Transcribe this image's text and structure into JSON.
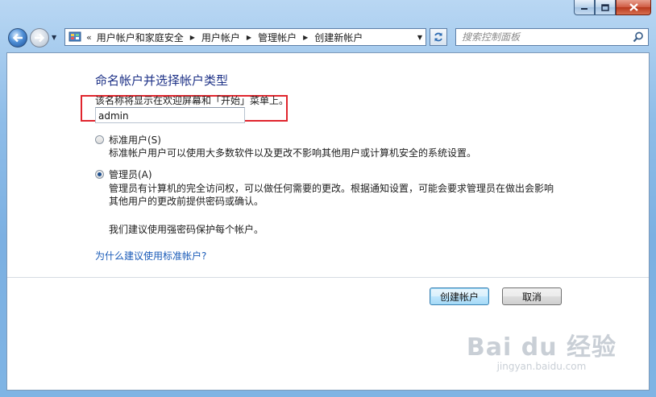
{
  "window": {
    "caption": {
      "min_icon": "minimize-icon",
      "max_icon": "maximize-icon",
      "close_icon": "close-icon"
    }
  },
  "nav": {
    "back_icon": "back-arrow-icon",
    "forward_icon": "forward-arrow-icon"
  },
  "address": {
    "chevron": "«",
    "crumbs": [
      "用户帐户和家庭安全",
      "用户帐户",
      "管理帐户",
      "创建新帐户"
    ]
  },
  "search": {
    "placeholder": "搜索控制面板"
  },
  "page": {
    "title": "命名帐户并选择帐户类型",
    "hint": "该名称将显示在欢迎屏幕和「开始」菜单上。",
    "name_value": "admin",
    "options": [
      {
        "label": "标准用户(S)",
        "selected": false,
        "desc": [
          "标准帐户用户可以使用大多数软件以及更改不影响其他用户或计算机安全的系统设置。"
        ]
      },
      {
        "label": "管理员(A)",
        "selected": true,
        "desc": [
          "管理员有计算机的完全访问权，可以做任何需要的更改。根据通知设置，可能会要求管理员在做出会影响",
          "其他用户的更改前提供密码或确认。"
        ]
      }
    ],
    "recommend": "我们建议使用强密码保护每个帐户。",
    "link": "为什么建议使用标准帐户?",
    "buttons": {
      "create": "创建帐户",
      "cancel": "取消"
    }
  },
  "watermark": {
    "brand": "Bai du 经验",
    "url": "jingyan.baidu.com"
  }
}
